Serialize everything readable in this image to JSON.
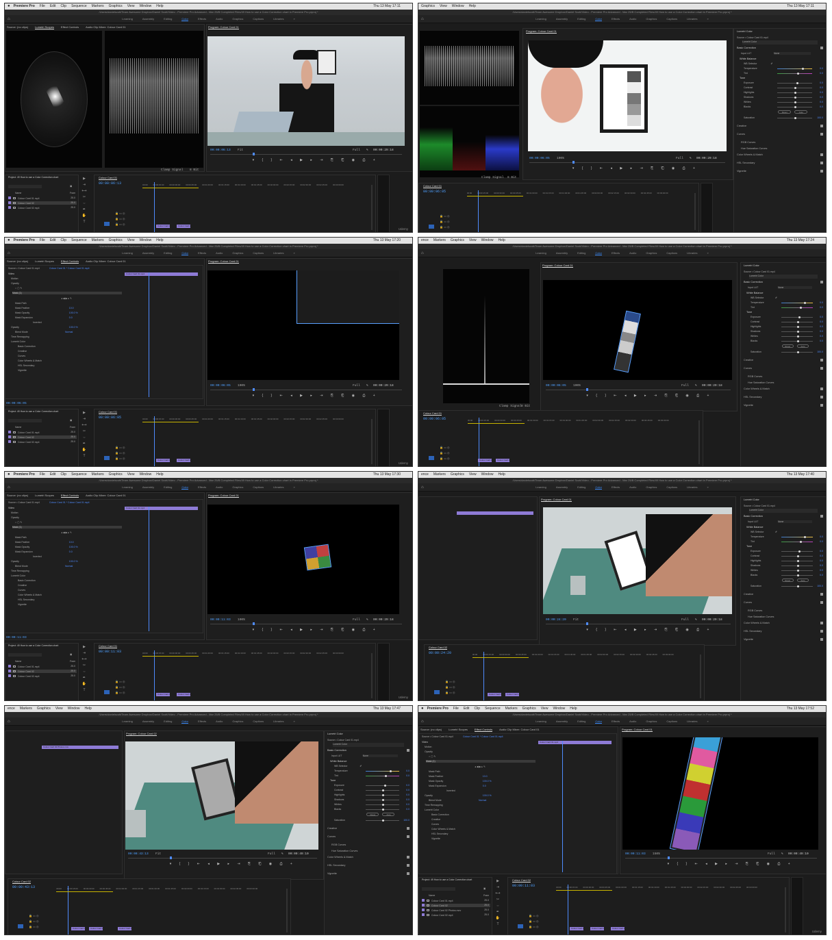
{
  "app": {
    "apple_icon": "apple-logo-icon",
    "app_name": "Premiere Pro",
    "menus": [
      "File",
      "Edit",
      "Clip",
      "Sequence",
      "Markers",
      "Graphics",
      "View",
      "Window",
      "Help"
    ],
    "menus_truncated": [
      "ence",
      "Markers",
      "Graphics",
      "View",
      "Window",
      "Help"
    ],
    "menus_short": [
      "Graphics",
      "View",
      "Window",
      "Help"
    ],
    "title": "/Users/danielscott/Team Awesome Dropbox/Daniel Scott/Video - Premiere Pro Advanced - Mar 25/B Completed Files/49 How to use a Color Correction chart in Premiere Pro.prproj *",
    "workspaces": [
      "Learning",
      "Assembly",
      "Editing",
      "Color",
      "Effects",
      "Audio",
      "Graphics",
      "Captions",
      "Libraries",
      "»"
    ],
    "active_workspace": "Color"
  },
  "frames": [
    {
      "clock": "Thu 13 May  17:11",
      "tabs": [
        "Source: (no clips)",
        "Lumetri Scopes",
        "Effect Controls",
        "Audio Clip Mixer: Colour Card 01"
      ],
      "active_tab": "Lumetri Scopes",
      "monitor": "Program: Colour Card 01",
      "tc_left": "00:00:06:13",
      "fit": "Fit",
      "quality": "Full",
      "tc_right": "00:00:29:18",
      "seq_tab": "Colour Card 01",
      "seq_tc": "00:00:06:13",
      "project": "Project: 49 How to use a Color Correction chart",
      "project_file": "49 How...rrection chart in Premiere Pro.prproj",
      "clips": [
        "Colour Card 01.mp4",
        "Colour Card 02",
        "Colour Card 02.mp4"
      ],
      "clamp": "Clamp Signal",
      "bit": "8 Bit"
    },
    {
      "clock": "Thu 13 May  17:11",
      "monitor": "Program: Colour Card 01",
      "lumetri": "Lumetri Color",
      "source": "Source • Colour Card 01.mp4",
      "fx": "Colour Card 01 * Colour Card...",
      "tc_left": "00:00:06:05",
      "zoom": "100%",
      "quality": "Full",
      "tc_right": "00:00:29:18",
      "seq_tc": "00:00:06:05",
      "seq_tab": "Colour Card 01",
      "clamp": "Clamp Signal",
      "bit": "8 Bit"
    },
    {
      "clock": "Thu 13 May  17:20",
      "tabs": [
        "Source: (no clips)",
        "Lumetri Scopes",
        "Effect Controls",
        "Audio Clip Mixer: Colour Card 01"
      ],
      "active_tab": "Effect Controls",
      "monitor": "Program: Colour Card 01",
      "tc_left": "00:00:06:05",
      "zoom": "100%",
      "quality": "Full",
      "tc_right": "00:00:29:18",
      "seq_tab": "Colour Card 01",
      "seq_tc": "00:00:06:05",
      "project": "Project: 49 How to use a Color Correction chart",
      "clips": [
        "Colour Card 01.mp4",
        "Colour Card 02",
        "Colour Card 02.mp4"
      ],
      "ec_tc": "00:00:06:05"
    },
    {
      "clock": "Thu 13 May  17:24",
      "monitor": "Program: Colour Card 01",
      "tc_left": "00:00:06:05",
      "zoom": "100%",
      "quality": "Full",
      "tc_right": "00:00:29:18",
      "seq_tc": "00:00:06:05",
      "seq_tab": "Colour Card 01",
      "clamp": "Clamp Signal",
      "bit": "8 Bit"
    },
    {
      "clock": "Thu 13 May  17:30",
      "tabs": [
        "Source: (no clips)",
        "Lumetri Scopes",
        "Effect Controls",
        "Audio Clip Mixer: Colour Card 01"
      ],
      "active_tab": "Effect Controls",
      "monitor": "Program: Colour Card 01",
      "tc_left": "00:00:11:03",
      "zoom": "100%",
      "quality": "Full",
      "tc_right": "00:00:29:18",
      "seq_tab": "Colour Card 01",
      "seq_tc": "00:00:11:03",
      "project": "Project: 49 How to use a Color Correction chart",
      "clips": [
        "Colour Card 01.mp4",
        "Colour Card 02",
        "Colour Card 02.mp4"
      ],
      "ec_tc": "00:00:11:03"
    },
    {
      "clock": "Thu 13 May  17:40",
      "monitor": "Program: Colour Card 01",
      "tc_left": "00:00:24:20",
      "fit": "Fit",
      "quality": "Full",
      "tc_right": "00:00:29:18",
      "seq_tc": "00:00:24:20",
      "seq_tab": "Colour Card 02"
    },
    {
      "clock": "Thu 13 May  17:47",
      "monitor": "Program: Colour Card 02",
      "tc_left": "00:00:43:13",
      "fit": "Fit",
      "quality": "Full",
      "tc_right": "00:00:49:10",
      "seq_tc": "00:00:43:13",
      "seq_tab": "Colour Card 02",
      "clip_name": "Colour Card 02 Photos.mov"
    },
    {
      "clock": "Thu 13 May  17:52",
      "tabs": [
        "Source: (no clips)",
        "Lumetri Scopes",
        "Effect Controls",
        "Audio Clip Mixer: Colour Card 01"
      ],
      "active_tab": "Effect Controls",
      "monitor": "Program: Colour Card 01",
      "tc_left": "00:00:11:03",
      "zoom": "150%",
      "quality": "Full",
      "tc_right": "00:00:49:10",
      "seq_tab": "Colour Card 02",
      "seq_tc": "00:00:11:03",
      "project": "Project: 49 How to use a Color Correction chart",
      "clips": [
        "Colour Card 01.mp4",
        "Colour Card 02",
        "Colour Card 02 Photos.mov",
        "Colour Card 02.mp4"
      ]
    }
  ],
  "lumetri_panel": {
    "title": "Lumetri Color",
    "basic": "Basic Correction",
    "input_lut": "Input LUT",
    "lut_value": "None",
    "white_balance": "White Balance",
    "wb_selector": "WB Selector",
    "tone": "Tone",
    "sliders": [
      {
        "label": "Temperature",
        "value": "0.0"
      },
      {
        "label": "Tint",
        "value": "0.0"
      },
      {
        "label": "Exposure",
        "value": "0.0"
      },
      {
        "label": "Contrast",
        "value": "0.0"
      },
      {
        "label": "Highlights",
        "value": "0.0"
      },
      {
        "label": "Shadows",
        "value": "0.0"
      },
      {
        "label": "Whites",
        "value": "0.0"
      },
      {
        "label": "Blacks",
        "value": "0.0"
      },
      {
        "label": "Saturation",
        "value": "100.0"
      }
    ],
    "reset": "Reset",
    "auto": "Auto",
    "sections": [
      "Creative",
      "Curves",
      "RGB Curves",
      "Hue Saturation Curves",
      "Color Wheels & Match",
      "HSL Secondary",
      "Vignette"
    ]
  },
  "effect_controls": {
    "source": "Source • Colour Card 01.mp4",
    "fx": "Colour Card 01 * Colour Card 01.mp4",
    "video": "Video",
    "motion": "Motion",
    "opacity": "Opacity",
    "mask": "Mask (1)",
    "mask_path": "Mask Path",
    "mask_feather": "Mask Feather",
    "feather_val": "10.0",
    "mask_opacity": "Mask Opacity",
    "mask_opacity_val": "100.0 %",
    "mask_expansion": "Mask Expansion",
    "expansion_val": "0.0",
    "inverted": "Inverted",
    "opacity_label": "Opacity",
    "opacity_val": "100.0 %",
    "blend": "Blend Mode",
    "blend_val": "Normal",
    "time_remap": "Time Remapping",
    "lumetri": "Lumetri Color",
    "lumetri_items": [
      "Basic Correction",
      "Creative",
      "Curves",
      "Color Wheels & Match",
      "HSL Secondary",
      "Vignette"
    ],
    "clip_bar": "Colour Card 01.mp4"
  },
  "project_cols": [
    "Name",
    "Fram"
  ],
  "fps": "25.0",
  "tools_icons": [
    "selection-tool-icon",
    "track-select-icon",
    "ripple-edit-icon",
    "razor-tool-icon",
    "slip-tool-icon",
    "pen-tool-icon",
    "hand-tool-icon",
    "type-tool-icon"
  ],
  "ruler": [
    "00:00",
    "00:00:15:00",
    "00:00:30:00",
    "00:00:45:00",
    "00:01:00:00",
    "00:01:15:00",
    "00:01:30:00",
    "00:01:45:00",
    "00:02:00:00",
    "00:02:15:00",
    "00:02:30:00",
    "00:02:45:00",
    "00:03:00:00"
  ],
  "watermark": "Udemy",
  "colors": {
    "accent": "#3a8cff",
    "clip": "#8e7bd6",
    "bg": "#1c1c1c",
    "menu": "#e3e3e3"
  }
}
